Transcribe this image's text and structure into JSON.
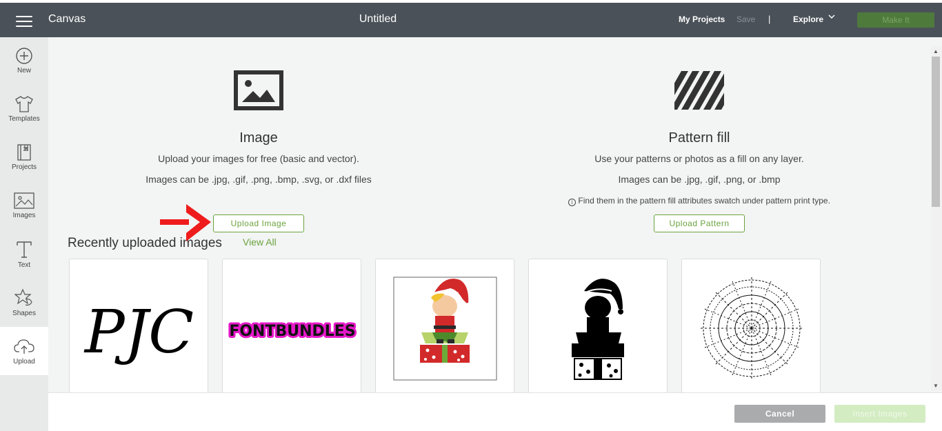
{
  "header": {
    "app_title": "Canvas",
    "doc_title": "Untitled",
    "my_projects": "My Projects",
    "save": "Save",
    "separator": "|",
    "explore": "Explore",
    "make_it": "Make It"
  },
  "sidebar": {
    "items": [
      {
        "label": "New",
        "icon": "plus-circle-icon"
      },
      {
        "label": "Templates",
        "icon": "tshirt-icon"
      },
      {
        "label": "Projects",
        "icon": "book-icon"
      },
      {
        "label": "Images",
        "icon": "image-icon"
      },
      {
        "label": "Text",
        "icon": "text-icon"
      },
      {
        "label": "Shapes",
        "icon": "shapes-icon"
      },
      {
        "label": "Upload",
        "icon": "cloud-upload-icon"
      }
    ]
  },
  "image_panel": {
    "title": "Image",
    "line1": "Upload your images for free (basic and vector).",
    "line2": "Images can be .jpg, .gif, .png, .bmp, .svg, or .dxf files",
    "button": "Upload Image"
  },
  "pattern_panel": {
    "title": "Pattern fill",
    "line1": "Use your patterns or photos as a fill on any layer.",
    "line2": "Images can be .jpg, .gif, .png, or .bmp",
    "note": "Find them in the pattern fill attributes swatch under pattern print type.",
    "button": "Upload Pattern"
  },
  "recent": {
    "title": "Recently uploaded images",
    "view_all": "View All",
    "thumbnails": [
      {
        "text": "PJC"
      },
      {
        "text": "FONTBUNDLES"
      },
      {
        "text": ""
      },
      {
        "text": ""
      },
      {
        "text": ""
      }
    ]
  },
  "footer": {
    "cancel": "Cancel",
    "insert": "Insert Images"
  },
  "colors": {
    "header_bg": "#4a5158",
    "accent_green": "#6aa33d",
    "arrow_red": "#ee1c1c"
  }
}
